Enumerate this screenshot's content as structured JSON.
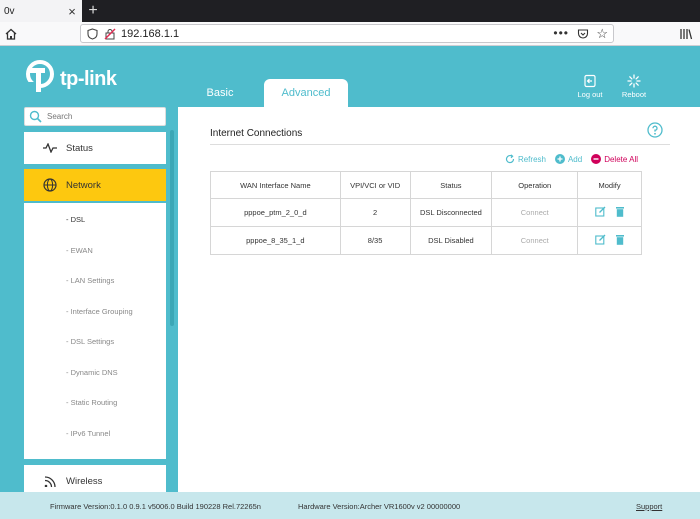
{
  "browser": {
    "tab_title": "0v",
    "tab_close": "×",
    "new_tab": "+",
    "url": "192.168.1.1",
    "url_more": "•••",
    "bookmark_star": "☆"
  },
  "header": {
    "logo_text": "tp-link",
    "tabs": {
      "basic": "Basic",
      "advanced": "Advanced"
    },
    "logout_label": "Log out",
    "reboot_label": "Reboot"
  },
  "sidebar": {
    "search_placeholder": "Search",
    "status_label": "Status",
    "network_label": "Network",
    "wireless_label": "Wireless",
    "network_items": [
      "- DSL",
      "- EWAN",
      "- LAN Settings",
      "- Interface Grouping",
      "- DSL Settings",
      "- Dynamic DNS",
      "- Static Routing",
      "- IPv6 Tunnel"
    ]
  },
  "content": {
    "section_title": "Internet Connections",
    "actions": {
      "refresh": "Refresh",
      "add": "Add",
      "delete_all": "Delete All"
    },
    "table": {
      "headers": [
        "WAN Interface Name",
        "VPI/VCI or VID",
        "Status",
        "Operation",
        "Modify"
      ],
      "rows": [
        {
          "name": "pppoe_ptm_2_0_d",
          "vid": "2",
          "status": "DSL Disconnected",
          "operation": "Connect"
        },
        {
          "name": "pppoe_8_35_1_d",
          "vid": "8/35",
          "status": "DSL Disabled",
          "operation": "Connect"
        }
      ]
    }
  },
  "footer": {
    "firmware": "Firmware Version:0.1.0 0.9.1 v5006.0 Build 190228 Rel.72265n",
    "hardware": "Hardware Version:Archer VR1600v v2 00000000",
    "support": "Support"
  },
  "colors": {
    "accent": "#4fbccc",
    "active_nav": "#fdc80f",
    "delete": "#d0005a"
  }
}
